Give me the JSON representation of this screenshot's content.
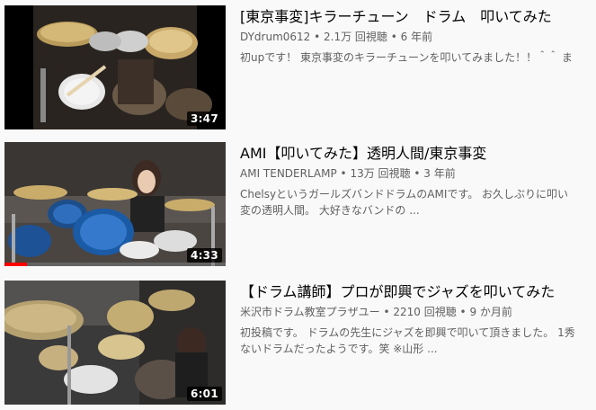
{
  "videos": [
    {
      "title": "[東京事変]キラーチューン　ドラム　叩いてみた",
      "channel": "DYdrum0612",
      "separator": " • ",
      "views": "2.1万 回視聴",
      "age": "6 年前",
      "description_lines": [
        "初upです！ 東京事変のキラーチューンを叩いてみました！！＾＾ ま",
        ""
      ],
      "duration": "3:47",
      "watched_fraction": 0
    },
    {
      "title": "AMI【叩いてみた】透明人間/東京事変",
      "channel": "AMI TENDERLAMP",
      "separator": " • ",
      "views": "13万 回視聴",
      "age": "3 年前",
      "description_lines": [
        "ChelsyというガールズバンドドラムのAMIです。 お久しぶりに叩い",
        "変の透明人間。 大好きなバンドの ..."
      ],
      "duration": "4:33",
      "watched_fraction": 0.1
    },
    {
      "title": "【ドラム講師】プロが即興でジャズを叩いてみた",
      "channel": "米沢市ドラム教室プラザユー",
      "separator": " • ",
      "views": "2210 回視聴",
      "age": "9 か月前",
      "description_lines": [
        "初投稿です。 ドラムの先生にジャズを即興で叩いて頂きました。 1秀",
        "ないドラムだったようです。笑 ※山形 ..."
      ],
      "duration": "6:01",
      "watched_fraction": 0
    }
  ],
  "colors": {
    "title": "#030303",
    "meta": "#606060",
    "progress": "#ff0000",
    "background": "#f9f9f9"
  }
}
